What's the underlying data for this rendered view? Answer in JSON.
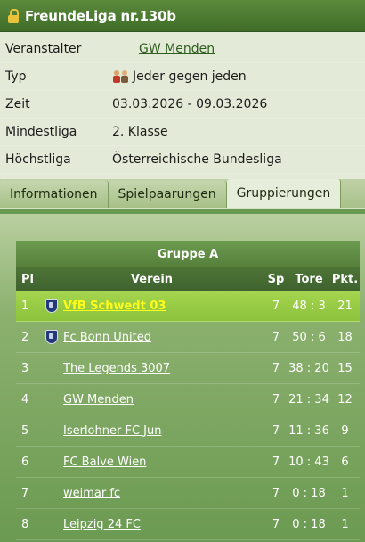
{
  "window": {
    "title": "FreundeLiga nr.130b"
  },
  "info": [
    {
      "label": "Veranstalter",
      "value": "GW Menden",
      "link": true
    },
    {
      "label": "Typ",
      "value": "Jeder gegen jeden",
      "icon": "players-icon"
    },
    {
      "label": "Zeit",
      "value": "03.03.2026 - 09.03.2026"
    },
    {
      "label": "Mindestliga",
      "value": "2. Klasse"
    },
    {
      "label": "Höchstliga",
      "value": "Österreichische Bundesliga"
    }
  ],
  "tabs": [
    {
      "label": "Informationen",
      "active": false
    },
    {
      "label": "Spielpaarungen",
      "active": false
    },
    {
      "label": "Gruppierungen",
      "active": true
    }
  ],
  "group": {
    "title": "Gruppe A",
    "headers": {
      "pl": "Pl",
      "verein": "Verein",
      "sp": "Sp",
      "tore": "Tore",
      "pkt": "Pkt."
    },
    "rows": [
      {
        "pl": "1",
        "name": "VfB Schwedt 03",
        "crest": true,
        "sp": "7",
        "tore": "48 : 3",
        "pkt": "21",
        "highlight": true
      },
      {
        "pl": "2",
        "name": "Fc Bonn United",
        "crest": true,
        "sp": "7",
        "tore": "50 : 6",
        "pkt": "18"
      },
      {
        "pl": "3",
        "name": "The Legends 3007",
        "crest": false,
        "sp": "7",
        "tore": "38 : 20",
        "pkt": "15"
      },
      {
        "pl": "4",
        "name": "GW Menden",
        "crest": false,
        "sp": "7",
        "tore": "21 : 34",
        "pkt": "12"
      },
      {
        "pl": "5",
        "name": "Iserlohner FC Jun",
        "crest": false,
        "sp": "7",
        "tore": "11 : 36",
        "pkt": "9"
      },
      {
        "pl": "6",
        "name": "FC Balve Wien",
        "crest": false,
        "sp": "7",
        "tore": "10 : 43",
        "pkt": "6"
      },
      {
        "pl": "7",
        "name": "weimar fc",
        "crest": false,
        "sp": "7",
        "tore": "0 : 18",
        "pkt": "1"
      },
      {
        "pl": "8",
        "name": "Leipzig 24 FC",
        "crest": false,
        "sp": "7",
        "tore": "0 : 18",
        "pkt": "1"
      }
    ]
  }
}
